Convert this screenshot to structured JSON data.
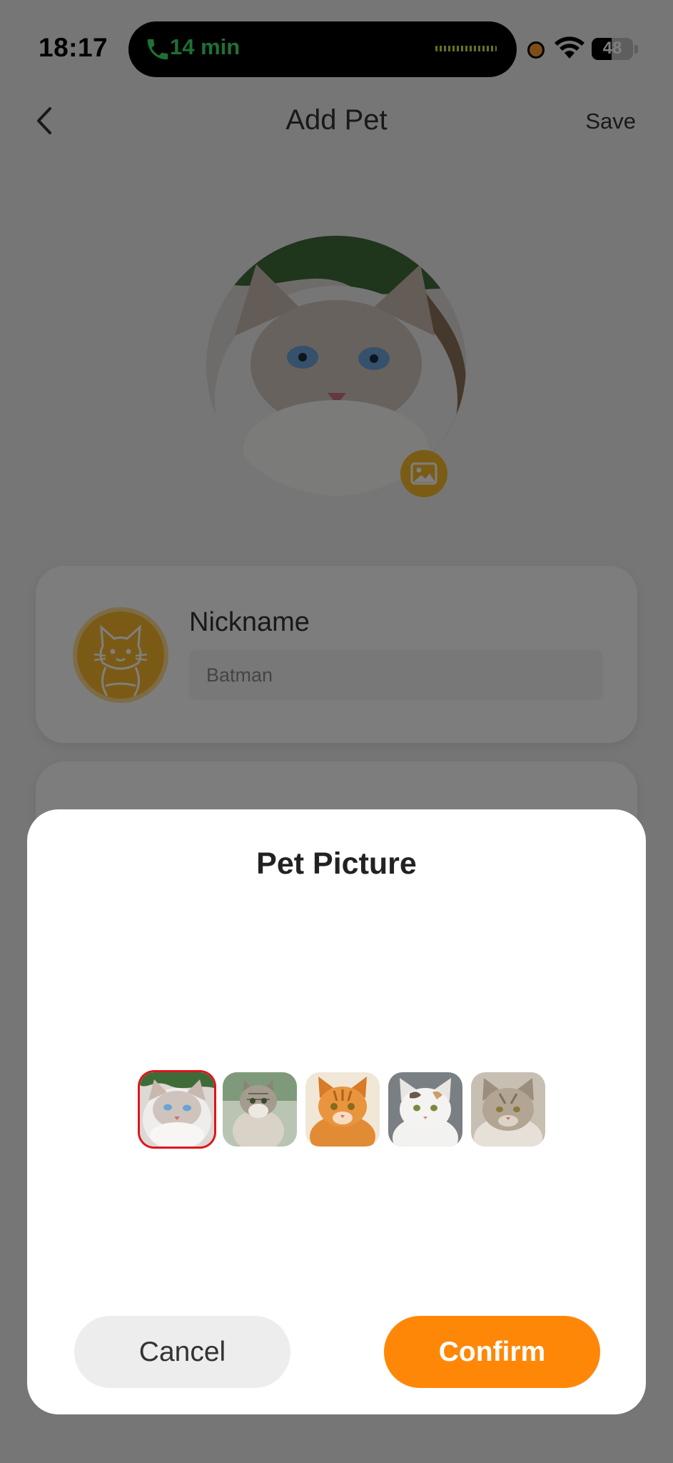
{
  "status_bar": {
    "time": "18:17",
    "call_duration": "14 min",
    "battery_level": "48",
    "battery_fraction": 0.48
  },
  "nav": {
    "title": "Add Pet",
    "save_label": "Save",
    "back_icon": "chevron-left-icon"
  },
  "avatar": {
    "edit_icon": "image-icon"
  },
  "nickname_card": {
    "label": "Nickname",
    "value": "Batman",
    "icon": "cat-icon"
  },
  "modal": {
    "title": "Pet Picture",
    "selected_index": 0,
    "thumbnails": [
      "ragdoll-cat",
      "tabby-kitten",
      "orange-tabby-cat",
      "white-calico-cat",
      "grey-longhair-cat"
    ],
    "cancel_label": "Cancel",
    "confirm_label": "Confirm"
  },
  "colors": {
    "accent_orange": "#ff8708",
    "icon_yellow": "#f5b82a",
    "selected_border": "#e0141b",
    "call_green": "#3ee06a"
  }
}
